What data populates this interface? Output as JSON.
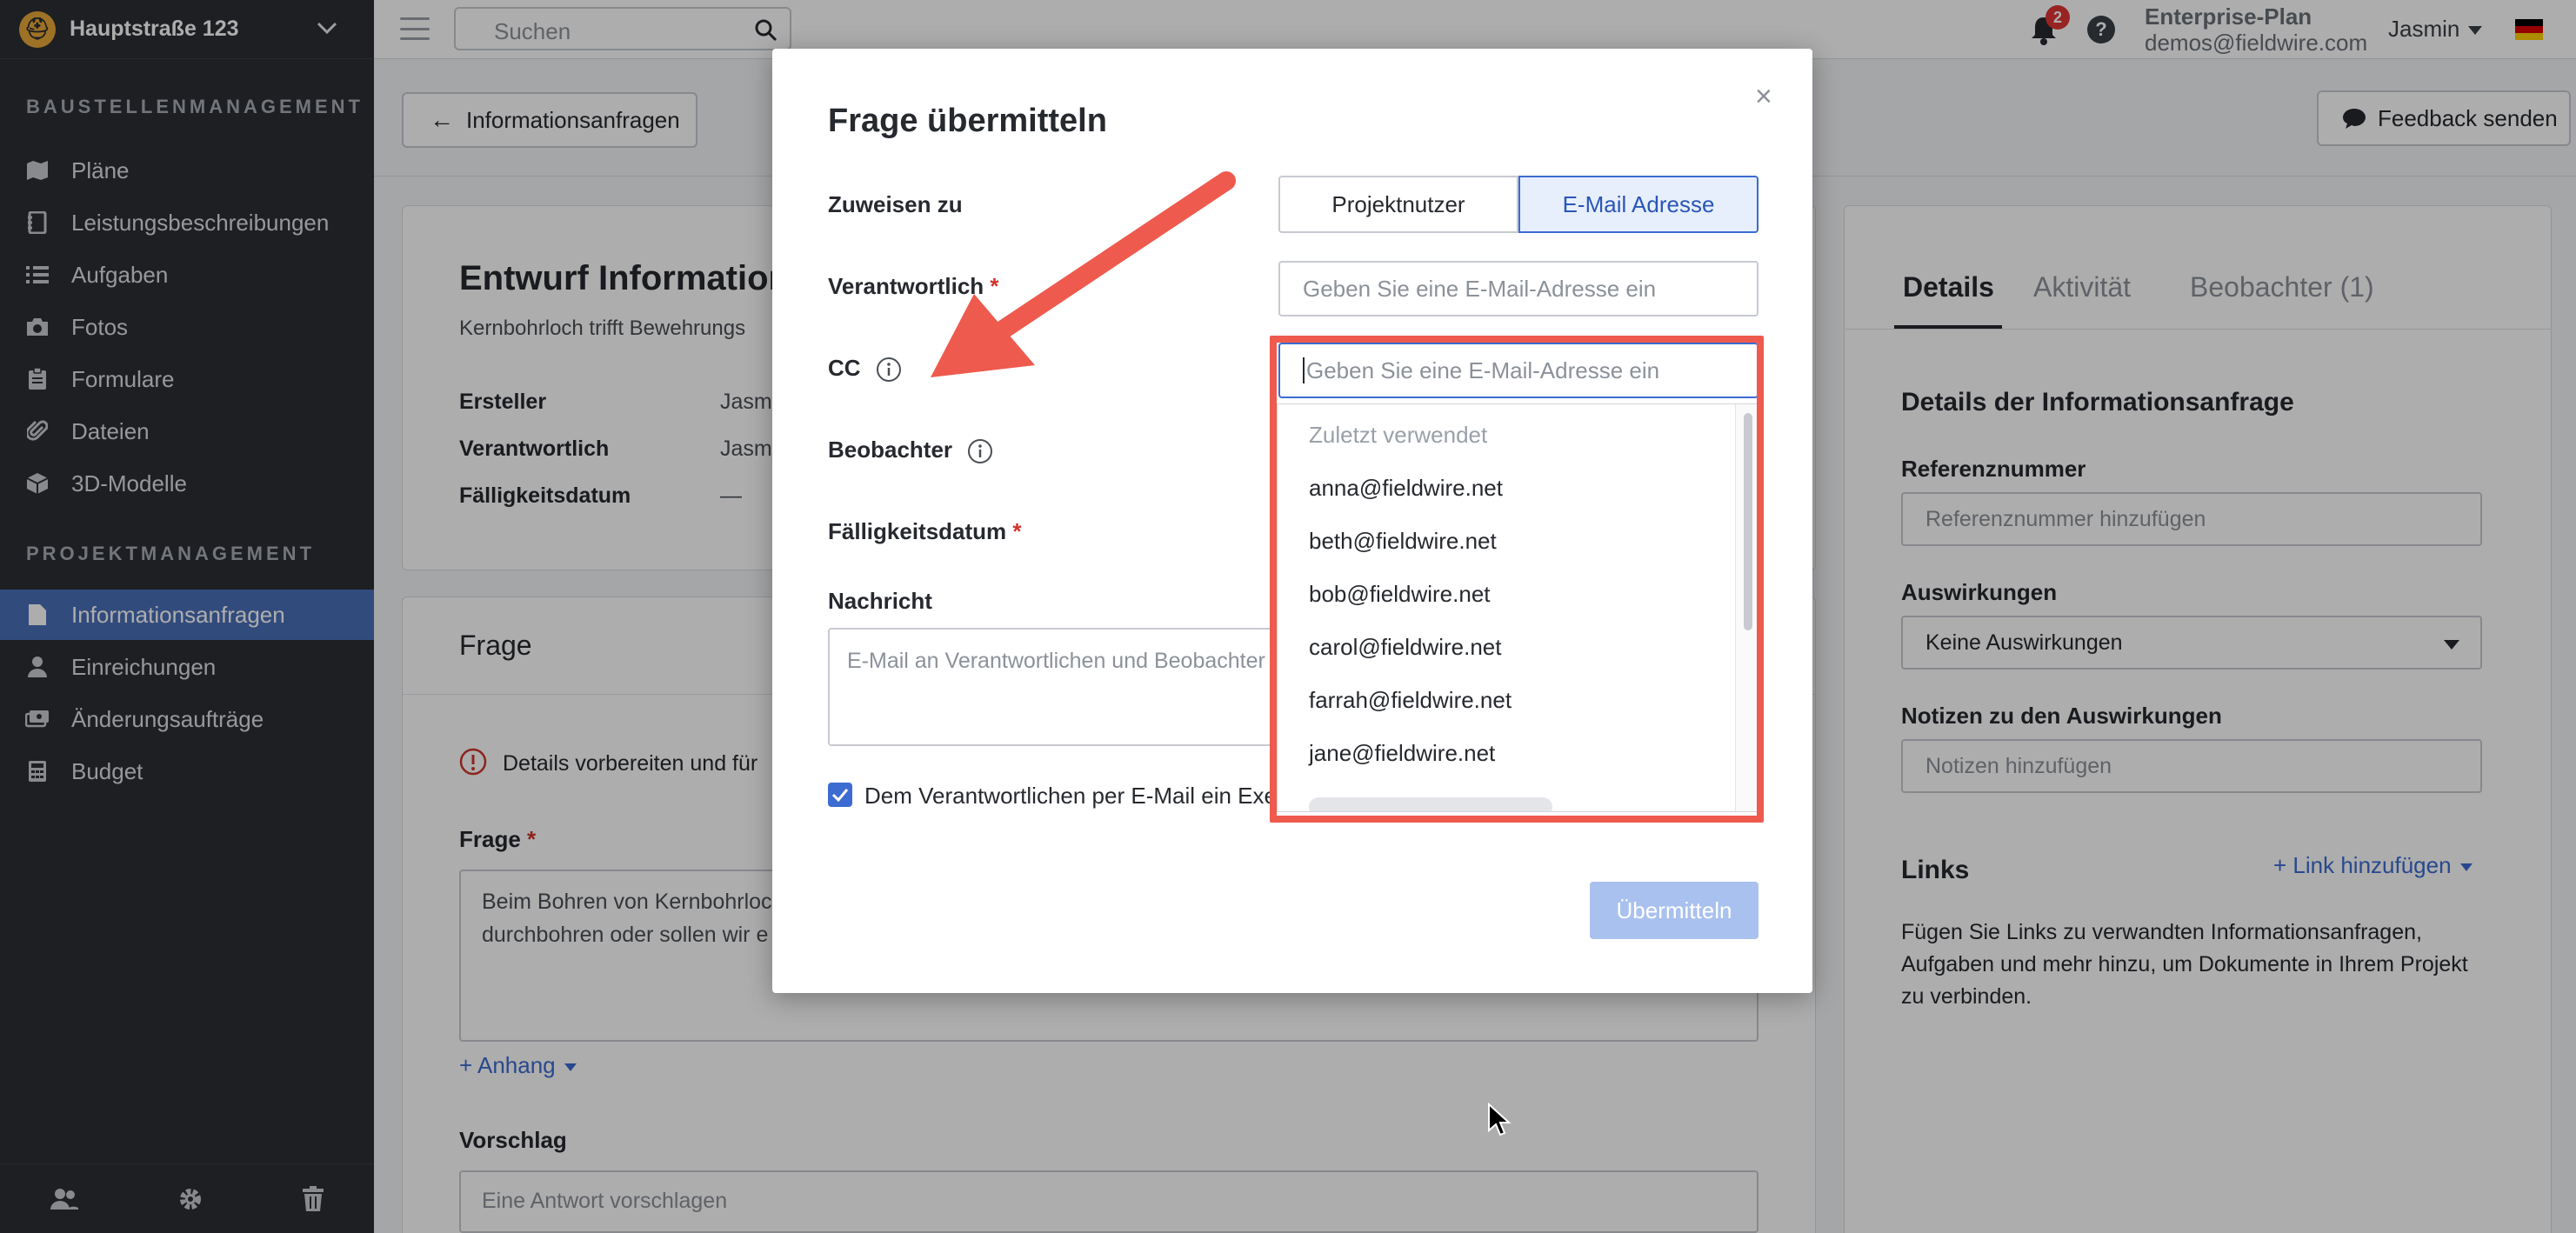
{
  "sidebar": {
    "project_name": "Hauptstraße 123",
    "section_construction": "BAUSTELLENMANAGEMENT",
    "section_project": "PROJEKTMANAGEMENT",
    "construction_items": [
      {
        "label": "Pläne",
        "icon": "map-icon"
      },
      {
        "label": "Leistungsbeschreibungen",
        "icon": "notebook-icon"
      },
      {
        "label": "Aufgaben",
        "icon": "list-icon"
      },
      {
        "label": "Fotos",
        "icon": "camera-icon"
      },
      {
        "label": "Formulare",
        "icon": "clipboard-icon"
      },
      {
        "label": "Dateien",
        "icon": "paperclip-icon"
      },
      {
        "label": "3D-Modelle",
        "icon": "cube-icon"
      }
    ],
    "project_items": [
      {
        "label": "Informationsanfragen",
        "icon": "document-icon",
        "active": true
      },
      {
        "label": "Einreichungen",
        "icon": "user-icon"
      },
      {
        "label": "Änderungsaufträge",
        "icon": "money-icon"
      },
      {
        "label": "Budget",
        "icon": "calculator-icon"
      }
    ]
  },
  "topbar": {
    "search_placeholder": "Suchen",
    "notification_count": "2",
    "plan_name": "Enterprise-Plan",
    "plan_email": "demos@fieldwire.com",
    "user_name": "Jasmin"
  },
  "page": {
    "back_label": "Informationsanfragen",
    "feedback_label": "Feedback senden",
    "draft_title": "Entwurf Information",
    "draft_subtitle": "Kernbohrloch trifft Bewehrungs",
    "meta": [
      {
        "label": "Ersteller",
        "value": "Jasm"
      },
      {
        "label": "Verantwortlich",
        "value": "Jasm"
      },
      {
        "label": "Fälligkeitsdatum",
        "value": "—"
      }
    ],
    "question_header": "Frage",
    "warning_text": "Details vorbereiten und für",
    "question_label": "Frage",
    "question_text_1": "Beim Bohren von Kernbohrloc",
    "question_text_2": "durchbohren oder sollen wir e",
    "attach_label": "+ Anhang",
    "proposal_label": "Vorschlag",
    "proposal_placeholder": "Eine Antwort vorschlagen"
  },
  "right_panel": {
    "tabs": [
      "Details",
      "Aktivität",
      "Beobachter (1)"
    ],
    "details_heading": "Details der Informationsanfrage",
    "ref_label": "Referenznummer",
    "ref_placeholder": "Referenznummer hinzufügen",
    "impact_label": "Auswirkungen",
    "impact_value": "Keine Auswirkungen",
    "impact_notes_label": "Notizen zu den Auswirkungen",
    "impact_notes_placeholder": "Notizen hinzufügen",
    "links_heading": "Links",
    "links_add": "+ Link hinzufügen",
    "links_text": "Fügen Sie Links zu verwandten Informationsanfragen, Aufgaben und mehr hinzu, um Dokumente in Ihrem Projekt zu verbinden."
  },
  "modal": {
    "title": "Frage übermitteln",
    "assign_label": "Zuweisen zu",
    "assign_options": [
      "Projektnutzer",
      "E-Mail Adresse"
    ],
    "assign_selected": "E-Mail Adresse",
    "responsible_label": "Verantwortlich",
    "responsible_placeholder": "Geben Sie eine E-Mail-Adresse ein",
    "cc_label": "CC",
    "cc_placeholder": "Geben Sie eine E-Mail-Adresse ein",
    "observer_label": "Beobachter",
    "due_label": "Fälligkeitsdatum",
    "message_label": "Nachricht",
    "message_placeholder": "E-Mail an Verantwortlichen und Beobachter",
    "checkbox_label": "Dem Verantwortlichen per E-Mail ein Exem",
    "checkbox_checked": true,
    "submit_label": "Übermitteln",
    "dropdown": {
      "header": "Zuletzt verwendet",
      "items": [
        "anna@fieldwire.net",
        "beth@fieldwire.net",
        "bob@fieldwire.net",
        "carol@fieldwire.net",
        "farrah@fieldwire.net",
        "jane@fieldwire.net"
      ]
    }
  },
  "colors": {
    "sidebar_bg": "#2b2e33",
    "active_item": "#4b6fb8",
    "accent": "#3c6bd1",
    "annotation": "#ee5a4d"
  }
}
